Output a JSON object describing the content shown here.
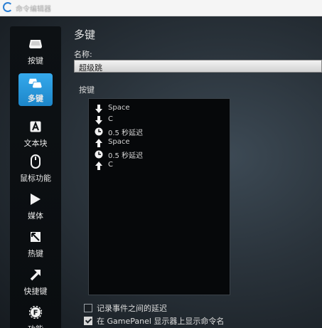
{
  "window": {
    "title": "命令编辑器"
  },
  "sidebar": {
    "items": [
      {
        "label": "按键",
        "icon": "key-icon",
        "active": false
      },
      {
        "label": "多键",
        "icon": "multi-key-icon",
        "active": true
      },
      {
        "label": "文本块",
        "icon": "text-block-icon",
        "active": false
      },
      {
        "label": "鼠标功能",
        "icon": "mouse-icon",
        "active": false
      },
      {
        "label": "媒体",
        "icon": "play-icon",
        "active": false
      },
      {
        "label": "热键",
        "icon": "hotkey-icon",
        "active": false
      },
      {
        "label": "快捷键",
        "icon": "shortcut-arrow-icon",
        "active": false
      },
      {
        "label": "功能",
        "icon": "function-gear-icon",
        "active": false
      }
    ]
  },
  "main": {
    "heading": "多键",
    "name_label": "名称:",
    "name_value": "超级跳",
    "keys_label": "按键",
    "events": [
      {
        "icon": "key-down-arrow-icon",
        "text": "Space"
      },
      {
        "icon": "key-down-arrow-icon",
        "text": "C"
      },
      {
        "icon": "clock-icon",
        "text": "0.5 秒延迟"
      },
      {
        "icon": "key-up-arrow-icon",
        "text": "Space"
      },
      {
        "icon": "clock-icon",
        "text": "0.5 秒延迟"
      },
      {
        "icon": "key-up-arrow-icon",
        "text": "C"
      }
    ],
    "options": [
      {
        "label": "记录事件之间的延迟",
        "checked": false
      },
      {
        "label": "在 GamePanel 显示器上显示命令名",
        "checked": true
      }
    ]
  },
  "colors": {
    "accent": "#2a9ae0",
    "sidebar_bg": "#0b0f12",
    "list_bg": "#06080a"
  }
}
